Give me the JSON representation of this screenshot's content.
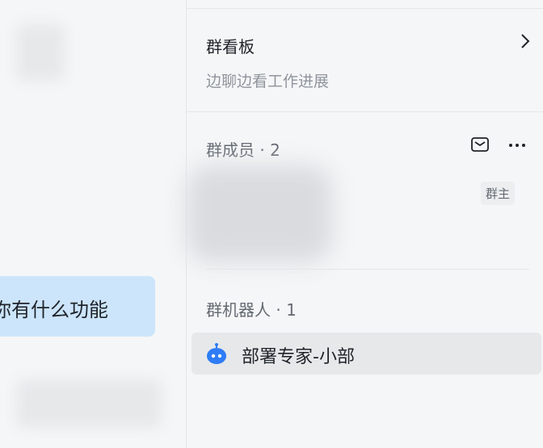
{
  "chat": {
    "bubble_text": "你有什么功能"
  },
  "sidebar": {
    "board": {
      "title": "群看板",
      "subtitle": "边聊边看工作进展"
    },
    "members": {
      "title": "群成员 · 2",
      "owner_badge": "群主"
    },
    "bots": {
      "title": "群机器人 · 1",
      "items": [
        {
          "name": "部署专家-小部"
        }
      ]
    }
  },
  "colors": {
    "accent": "#2e7cf6",
    "bubble": "#cce5fb"
  }
}
